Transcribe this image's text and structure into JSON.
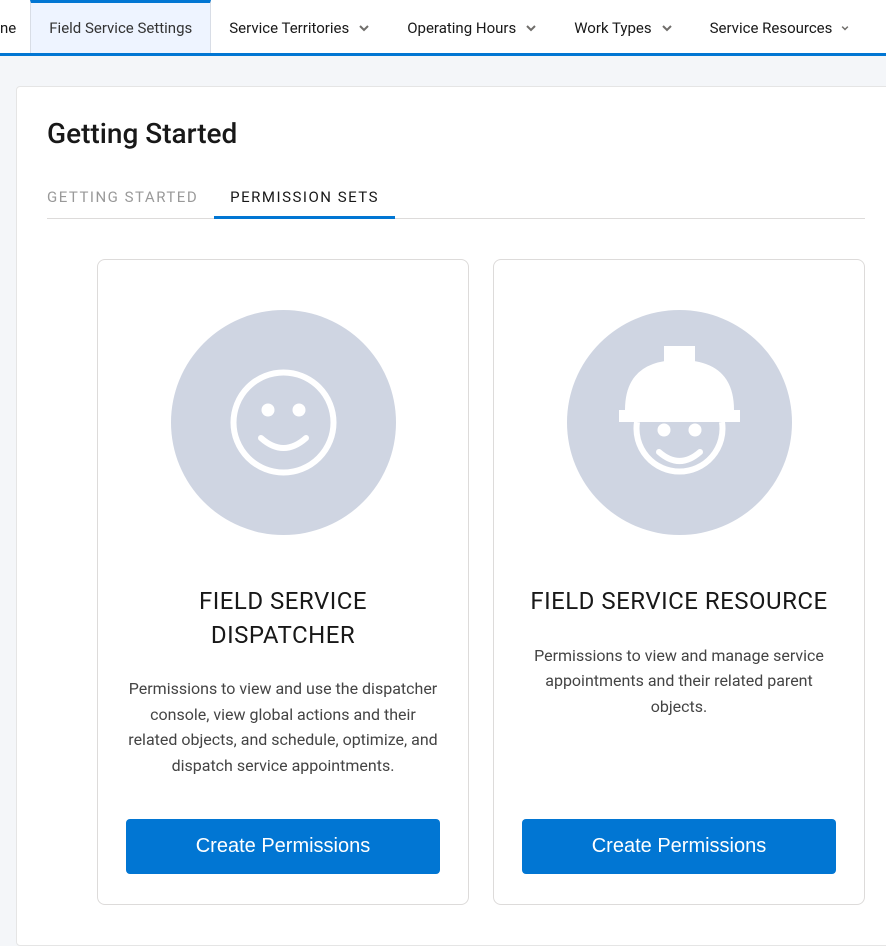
{
  "nav": {
    "items": [
      {
        "label": "ne",
        "active": false,
        "hasDropdown": false
      },
      {
        "label": "Field Service Settings",
        "active": true,
        "hasDropdown": false
      },
      {
        "label": "Service Territories",
        "active": false,
        "hasDropdown": true
      },
      {
        "label": "Operating Hours",
        "active": false,
        "hasDropdown": true
      },
      {
        "label": "Work Types",
        "active": false,
        "hasDropdown": true
      },
      {
        "label": "Service Resources",
        "active": false,
        "hasDropdown": true
      }
    ]
  },
  "page": {
    "title": "Getting Started"
  },
  "tabs": {
    "items": [
      {
        "label": "GETTING STARTED",
        "active": false
      },
      {
        "label": "PERMISSION SETS",
        "active": true
      }
    ]
  },
  "cards": {
    "dispatcher": {
      "title": "FIELD SERVICE DISPATCHER",
      "description": "Permissions to view and use the dispatcher console, view global actions and their related objects, and schedule, optimize, and dispatch service appointments.",
      "button": "Create Permissions"
    },
    "resource": {
      "title": "FIELD SERVICE RESOURCE",
      "description": "Permissions to view and manage service appointments and their related parent objects.",
      "button": "Create Permissions"
    }
  }
}
